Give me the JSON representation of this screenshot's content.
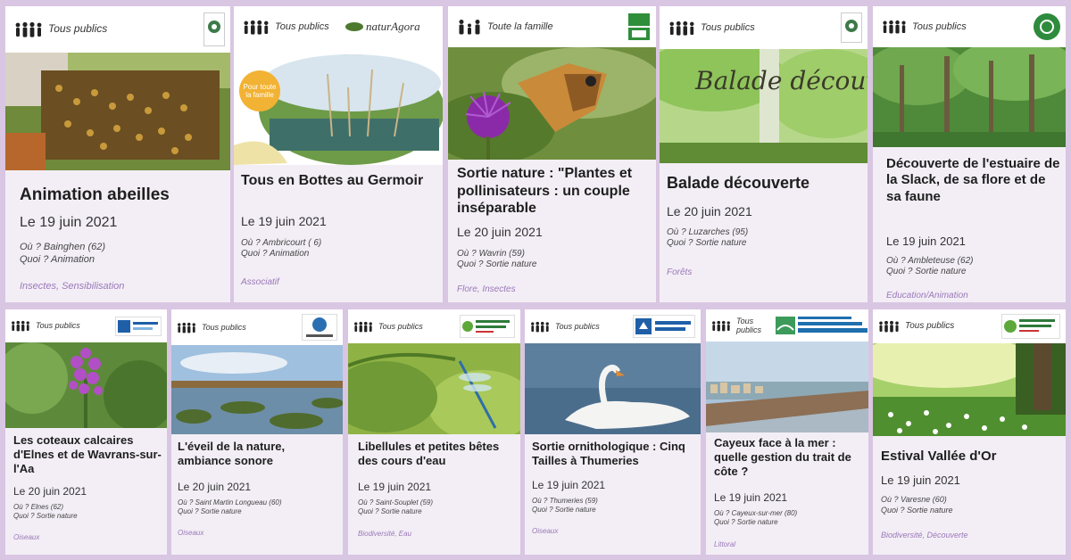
{
  "colors": {
    "background": "#d9c6e2",
    "card": "#f3eef6",
    "tag": "#9a78b7"
  },
  "icons": {
    "audience": "people-group-icon",
    "family": "family-icon"
  },
  "cards": [
    {
      "audience": "Tous publics",
      "title": "Animation abeilles",
      "date": "Le 19 juin 2021",
      "where": "Où ? Bainghen (62)",
      "what": "Quoi ? Animation",
      "tags": "Insectes, Sensibilisation",
      "logo": ""
    },
    {
      "audience": "Tous publics",
      "title": "Tous en Bottes au Germoir",
      "date": "Le 19 juin 2021",
      "where": "Où ? Ambricourt ( 6)",
      "what": "Quoi ? Animation",
      "tags": "Associatif",
      "logo": "naturAgora",
      "badge": "Pour toute la famille"
    },
    {
      "audience": "Toute la famille",
      "title": "Sortie nature : \"Plantes et pollinisateurs : un couple inséparable",
      "date": "Le 20 juin 2021",
      "where": "Où ? Wavrin (59)",
      "what": "Quoi ? Sortie nature",
      "tags": "Flore, Insectes",
      "logo": ""
    },
    {
      "audience": "Tous publics",
      "title": "Balade découverte",
      "date": "Le 20 juin 2021",
      "where": "Où ? Luzarches (95)",
      "what": "Quoi ? Sortie nature",
      "tags": "Forêts",
      "logo": "",
      "image_text": "Balade découverte"
    },
    {
      "audience": "Tous publics",
      "title": "Découverte de l'estuaire de la Slack, de sa flore et de sa faune",
      "date": "Le 19 juin 2021",
      "where": "Où ? Ambleteuse (62)",
      "what": "Quoi ? Sortie nature",
      "tags": "Education/Animation",
      "logo": ""
    },
    {
      "audience": "Tous publics",
      "title": "Les coteaux calcaires d'Elnes et de Wavrans-sur-l'Aa",
      "date": "Le 20 juin 2021",
      "where": "Où ? Elnes (62)",
      "what": "Quoi ? Sortie nature",
      "tags": "Oiseaux",
      "logo": ""
    },
    {
      "audience": "Tous publics",
      "title": "L'éveil de la nature, ambiance sonore",
      "date": "Le 20 juin 2021",
      "where": "Où ? Saint Martin Longueau (60)",
      "what": "Quoi ? Sortie nature",
      "tags": "Oiseaux",
      "logo": ""
    },
    {
      "audience": "Tous publics",
      "title": "Libellules et petites bêtes des cours d'eau",
      "date": "Le 19 juin 2021",
      "where": "Où ? Saint-Souplet (59)",
      "what": "Quoi ? Sortie nature",
      "tags": "Biodiversité, Eau",
      "logo": ""
    },
    {
      "audience": "Tous publics",
      "title": "Sortie ornithologique : Cinq Tailles à Thumeries",
      "date": "Le 19 juin 2021",
      "where": "Où ? Thumeries (59)",
      "what": "Quoi ? Sortie nature",
      "tags": "Oiseaux",
      "logo": ""
    },
    {
      "audience": "Tous publics",
      "title": "Cayeux face à la mer : quelle gestion du trait de côte ?",
      "date": "Le 19 juin 2021",
      "where": "Où ? Cayeux-sur-mer (80)",
      "what": "Quoi ? Sortie nature",
      "tags": "Littoral",
      "logo": ""
    },
    {
      "audience": "Tous publics",
      "title": "Estival Vallée d'Or",
      "date": "Le 19 juin 2021",
      "where": "Où ? Varesne (60)",
      "what": "Quoi ? Sortie nature",
      "tags": "Biodiversité, Découverte",
      "logo": ""
    }
  ]
}
